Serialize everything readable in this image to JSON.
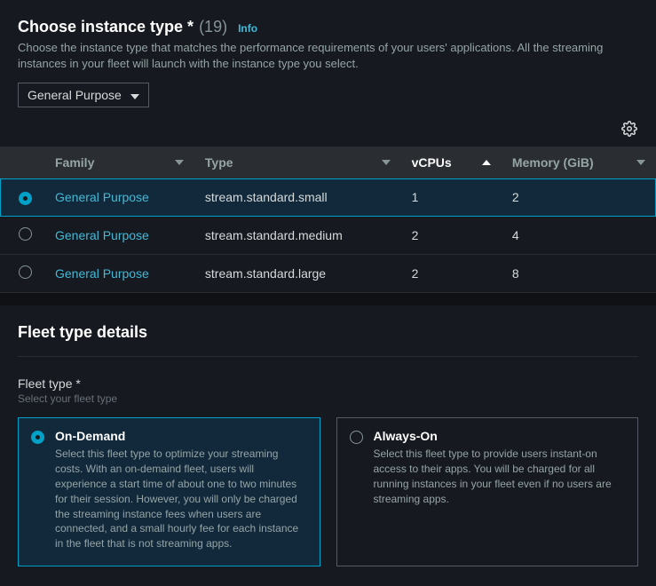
{
  "header": {
    "title": "Choose instance type *",
    "count": "(19)",
    "info": "Info",
    "description": "Choose the instance type that matches the performance requirements of your users' applications. All the streaming instances in your fleet will launch with the instance type you select."
  },
  "filter": {
    "selected": "General Purpose"
  },
  "table": {
    "columns": {
      "family": "Family",
      "type": "Type",
      "vcpus": "vCPUs",
      "memory": "Memory (GiB)"
    },
    "rows": [
      {
        "family": "General Purpose",
        "type": "stream.standard.small",
        "vcpus": "1",
        "memory": "2",
        "selected": true
      },
      {
        "family": "General Purpose",
        "type": "stream.standard.medium",
        "vcpus": "2",
        "memory": "4",
        "selected": false
      },
      {
        "family": "General Purpose",
        "type": "stream.standard.large",
        "vcpus": "2",
        "memory": "8",
        "selected": false
      }
    ]
  },
  "fleet": {
    "header": "Fleet type details",
    "label": "Fleet type *",
    "hint": "Select your fleet type",
    "options": [
      {
        "title": "On-Demand",
        "desc": "Select this fleet type to optimize your streaming costs. With an on-demaind fleet, users will experience a start time of about one to two minutes for their session. However, you will only be charged the streaming instance fees when users are connected, and a small hourly fee for each instance in the fleet that is not streaming apps.",
        "selected": true
      },
      {
        "title": "Always-On",
        "desc": "Select this fleet type to provide users instant-on access to their apps. You will be charged for all running instances in your fleet even if no users are streaming apps.",
        "selected": false
      }
    ]
  }
}
